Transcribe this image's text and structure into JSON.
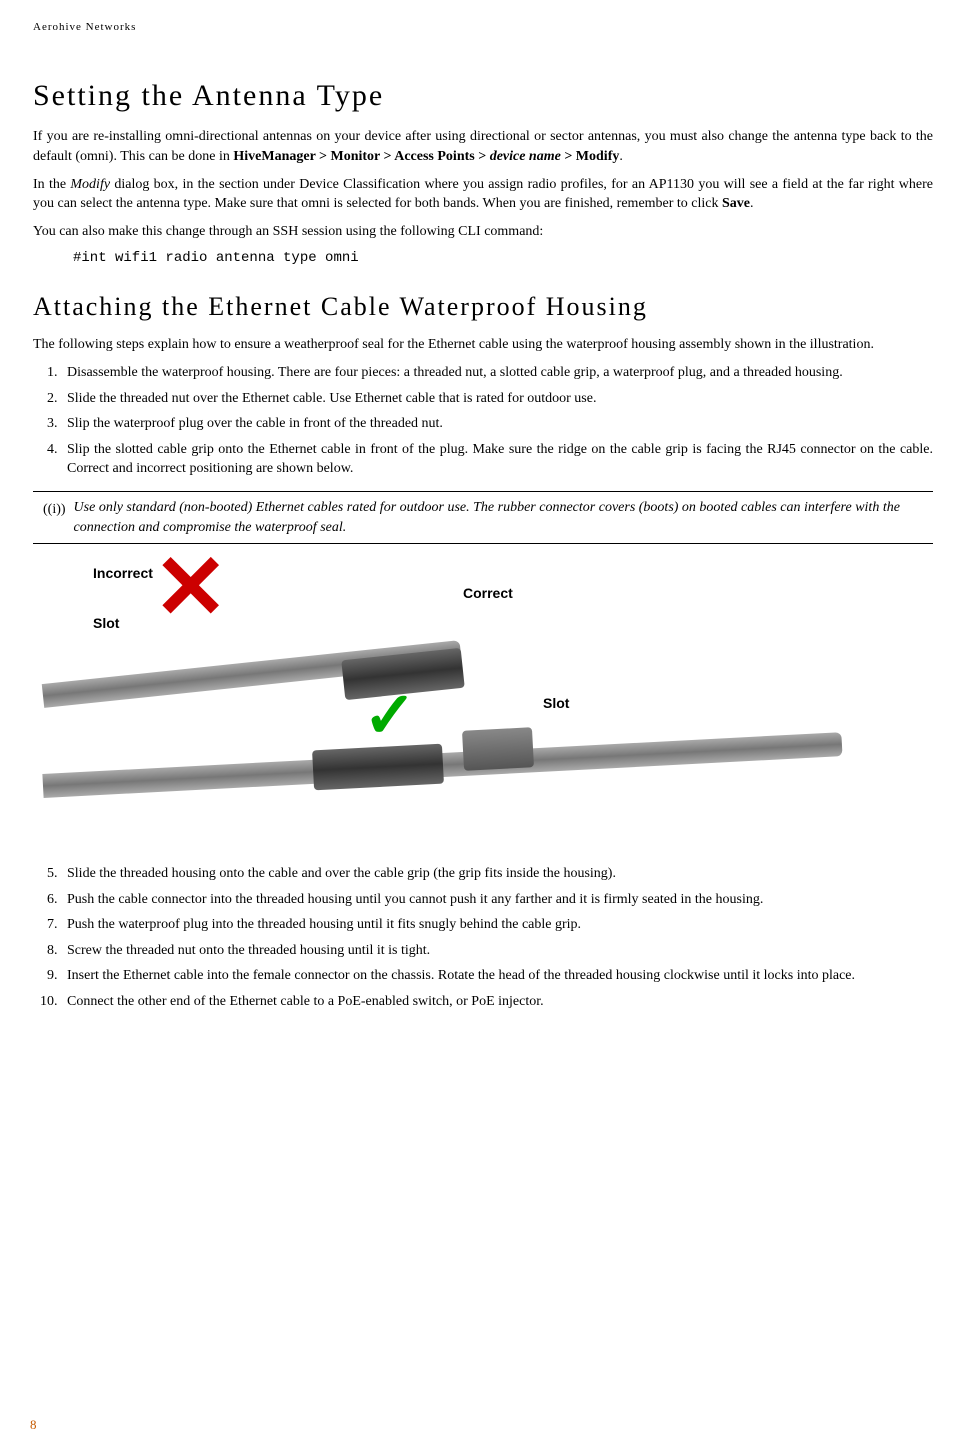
{
  "header": "Aerohive Networks",
  "page_number": "8",
  "section1": {
    "title": "Setting the Antenna Type",
    "p1_a": "If you are re-installing omni-directional antennas on your device after using directional or sector antennas, you must also change the antenna type back to the default (omni). This can be done in ",
    "p1_b": "HiveManager > Monitor > Access Points > ",
    "p1_c": "device name",
    "p1_d": " > Modify",
    "p1_e": ".",
    "p2_a": "In the ",
    "p2_b": "Modify",
    "p2_c": " dialog box, in the section under Device Classification where you assign radio profiles, for an AP1130 you will see a field at the far right where you can select the antenna type. Make sure that omni is selected for both bands. When you are finished, remember to click ",
    "p2_d": "Save",
    "p2_e": ".",
    "p3": "You can also make this change through an SSH session using the following CLI command:",
    "cli": "#int wifi1 radio antenna type omni"
  },
  "section2": {
    "title": "Attaching the Ethernet Cable Waterproof Housing",
    "intro": "The following steps explain how to ensure a weatherproof seal for the Ethernet cable using the waterproof housing assembly shown in the illustration.",
    "steps_a": [
      "Disassemble the waterproof housing. There are four pieces: a threaded nut, a slotted cable grip, a waterproof plug, and a threaded housing.",
      "Slide the threaded nut over the Ethernet cable. Use Ethernet cable that is rated for outdoor use.",
      "Slip the waterproof plug over the cable in front of the threaded nut.",
      "Slip the slotted cable grip onto the Ethernet cable in front of the plug. Make sure the ridge on the cable grip is facing the RJ45 connector on the cable. Correct and incorrect positioning are shown below."
    ],
    "note": "Use only standard (non-booted) Ethernet cables rated for outdoor use. The rubber connector covers (boots) on booted cables can interfere with the connection and compromise the waterproof seal.",
    "labels": {
      "incorrect": "Incorrect",
      "correct": "Correct",
      "slot1": "Slot",
      "slot2": "Slot"
    },
    "steps_b": [
      "Slide the threaded housing onto the cable and over the cable grip (the grip fits inside the housing).",
      "Push the cable connector into the threaded housing until you cannot push it any farther and it is firmly seated in the housing.",
      "Push the waterproof plug into the threaded housing until it fits snugly behind the cable grip.",
      "Screw the threaded nut onto the threaded housing until it is tight.",
      "Insert the Ethernet cable into the female connector on the chassis. Rotate the head of the threaded housing clockwise until it locks into place.",
      "Connect the other end of the Ethernet cable to a PoE-enabled switch, or PoE injector."
    ]
  }
}
